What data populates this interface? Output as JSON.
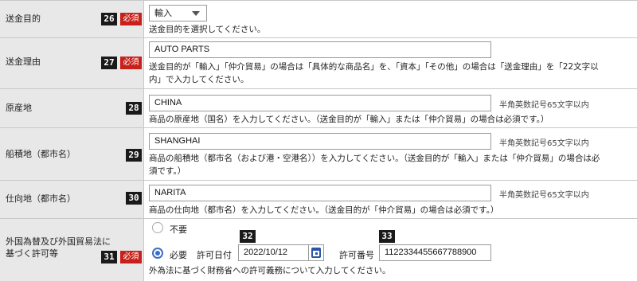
{
  "rows": {
    "purpose": {
      "label": "送金目的",
      "number": "26",
      "required": "必須",
      "select_value": "輸入",
      "help": "送金目的を選択してください。"
    },
    "reason": {
      "label": "送金理由",
      "number": "27",
      "required": "必須",
      "value": "AUTO PARTS",
      "help_line1": "送金目的が「輸入」「仲介貿易」の場合は「具体的な商品名」を、「資本」「その他」の場合は「送金理由」を「22文字以",
      "help_line2": "内」で入力してください。"
    },
    "origin": {
      "label": "原産地",
      "number": "28",
      "value": "CHINA",
      "hint": "半角英数記号65文字以内",
      "help": "商品の原産地（国名）を入力してください。（送金目的が「輸入」または「仲介貿易」の場合は必須です。）"
    },
    "loading": {
      "label": "船積地（都市名）",
      "number": "29",
      "value": "SHANGHAI",
      "hint": "半角英数記号65文字以内",
      "help_line1": "商品の船積地（都市名（および港・空港名））を入力してください。（送金目的が「輸入」または「仲介貿易」の場合は必",
      "help_line2": "須です。）"
    },
    "destination": {
      "label": "仕向地（都市名）",
      "number": "30",
      "value": "NARITA",
      "hint": "半角英数記号65文字以内",
      "help": "商品の仕向地（都市名）を入力してください。（送金目的が「仲介貿易」の場合は必須です。）"
    },
    "permit": {
      "label_line1": "外国為替及び外国貿易法に",
      "label_line2": "基づく許可等",
      "number": "31",
      "required": "必須",
      "option_none": "不要",
      "option_required": "必要",
      "date_label": "許可日付",
      "date_number": "32",
      "date_value": "2022/10/12",
      "permit_no_label": "許可番号",
      "permit_no_number": "33",
      "permit_no_value": "1122334455667788900",
      "selected_option": "必要",
      "help": "外為法に基づく財務省への許可義務について入力してください。"
    }
  }
}
